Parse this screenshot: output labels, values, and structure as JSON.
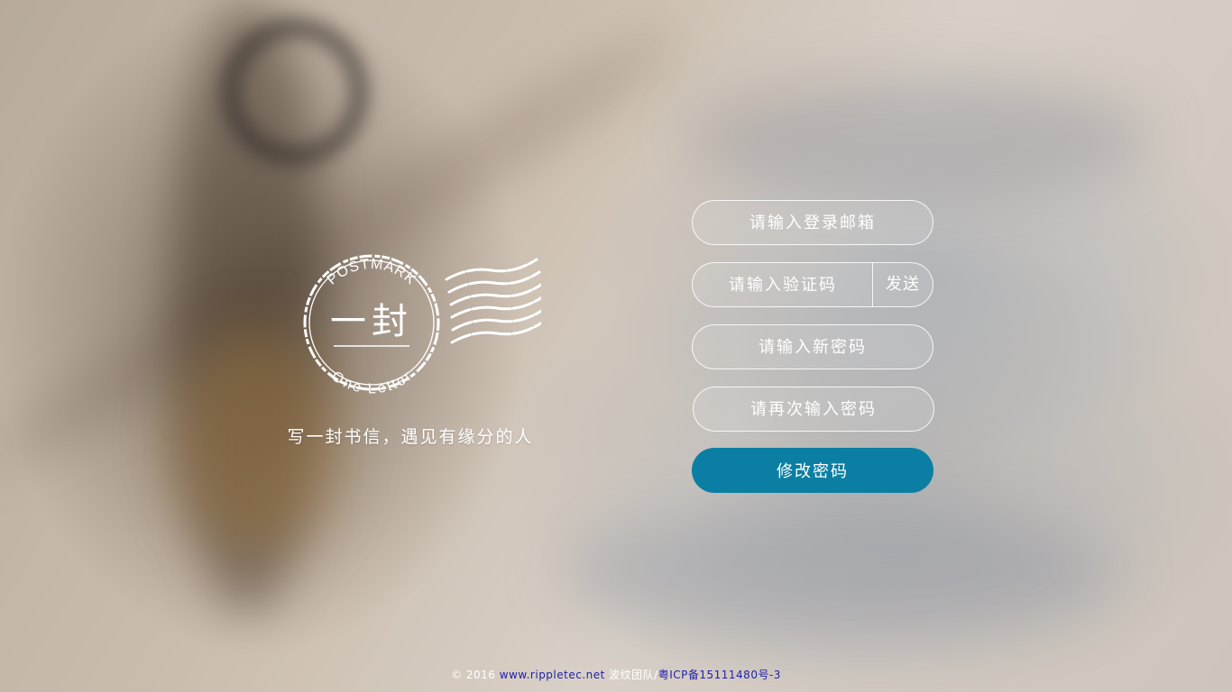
{
  "logo": {
    "ring_top_text": "POSTMARK",
    "center_text": "一封",
    "ring_bottom_text": "One Letter",
    "slogan": "写一封书信，遇见有缘分的人"
  },
  "form": {
    "email_placeholder": "请输入登录邮箱",
    "code_placeholder": "请输入验证码",
    "send_label": "发送",
    "new_password_placeholder": "请输入新密码",
    "confirm_password_placeholder": "请再次输入密码",
    "submit_label": "修改密码"
  },
  "footer": {
    "copyright": "© 2016",
    "site_link": "www.rippletec.net",
    "team": "波纹团队/",
    "icp": "粤ICP备15111480号-3"
  },
  "colors": {
    "submit": "#0b7fa3",
    "link": "#2222aa"
  }
}
